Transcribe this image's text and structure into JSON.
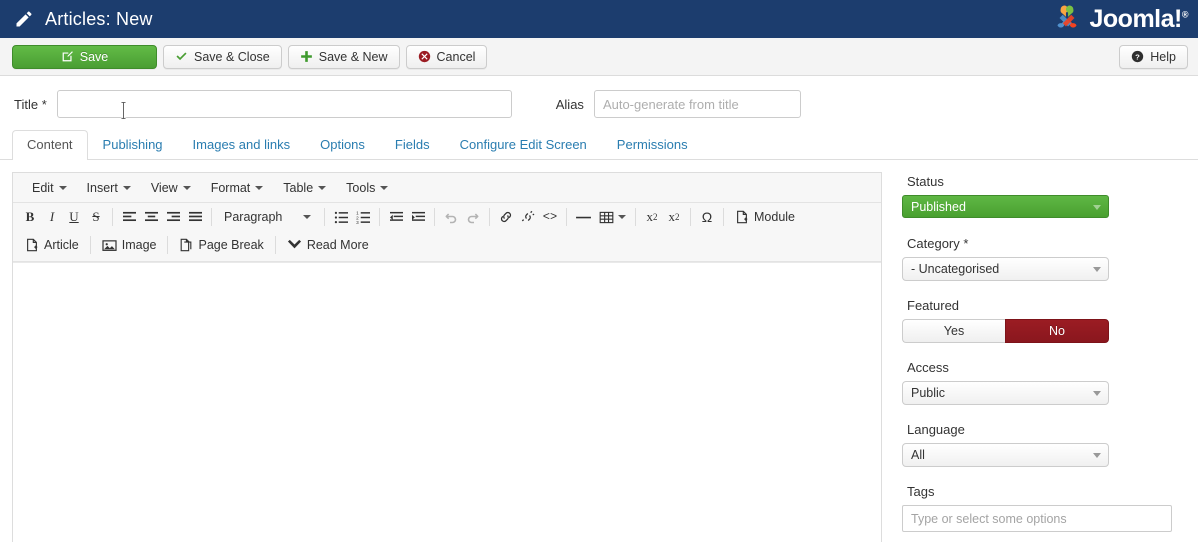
{
  "header": {
    "title": "Articles: New",
    "pencil_icon": "pencil-icon",
    "brand": "Joomla!",
    "brand_sup": "®"
  },
  "toolbar": {
    "save_label": "Save",
    "save_close_label": "Save & Close",
    "save_new_label": "Save & New",
    "cancel_label": "Cancel",
    "help_label": "Help"
  },
  "form": {
    "title_label": "Title *",
    "title_value": "",
    "title_placeholder": "",
    "alias_label": "Alias",
    "alias_value": "",
    "alias_placeholder": "Auto-generate from title"
  },
  "tabs": [
    {
      "label": "Content",
      "active": true
    },
    {
      "label": "Publishing",
      "active": false
    },
    {
      "label": "Images and links",
      "active": false
    },
    {
      "label": "Options",
      "active": false
    },
    {
      "label": "Fields",
      "active": false
    },
    {
      "label": "Configure Edit Screen",
      "active": false
    },
    {
      "label": "Permissions",
      "active": false
    }
  ],
  "editor": {
    "menubar": [
      "Edit",
      "Insert",
      "View",
      "Format",
      "Table",
      "Tools"
    ],
    "format_select": "Paragraph",
    "content": "",
    "row1_buttons": [
      {
        "name": "bold-icon",
        "glyph": "B"
      },
      {
        "name": "italic-icon",
        "glyph": "I"
      },
      {
        "name": "underline-icon",
        "glyph": "U"
      },
      {
        "name": "strikethrough-icon",
        "glyph": "S"
      },
      {
        "name": "align-left-icon",
        "glyph": ""
      },
      {
        "name": "align-center-icon",
        "glyph": ""
      },
      {
        "name": "align-right-icon",
        "glyph": ""
      },
      {
        "name": "align-justify-icon",
        "glyph": ""
      },
      {
        "name": "bullet-list-icon",
        "glyph": ""
      },
      {
        "name": "numbered-list-icon",
        "glyph": ""
      },
      {
        "name": "outdent-icon",
        "glyph": ""
      },
      {
        "name": "indent-icon",
        "glyph": ""
      },
      {
        "name": "undo-icon",
        "glyph": ""
      },
      {
        "name": "redo-icon",
        "glyph": ""
      },
      {
        "name": "link-icon",
        "glyph": ""
      },
      {
        "name": "unlink-icon",
        "glyph": ""
      },
      {
        "name": "source-code-icon",
        "glyph": "<>"
      },
      {
        "name": "horizontal-rule-icon",
        "glyph": "—"
      },
      {
        "name": "table-icon",
        "glyph": ""
      },
      {
        "name": "subscript-icon",
        "glyph": "x₂"
      },
      {
        "name": "superscript-icon",
        "glyph": "x²"
      },
      {
        "name": "special-character-icon",
        "glyph": "Ω"
      }
    ],
    "module_label": "Module",
    "row2_buttons": [
      {
        "name": "insert-article-button",
        "label": "Article"
      },
      {
        "name": "insert-image-button",
        "label": "Image"
      },
      {
        "name": "insert-page-break-button",
        "label": "Page Break"
      },
      {
        "name": "insert-read-more-button",
        "label": "Read More"
      }
    ]
  },
  "sidebar": {
    "status_label": "Status",
    "status_value": "Published",
    "category_label": "Category *",
    "category_value": "- Uncategorised",
    "featured_label": "Featured",
    "featured_yes": "Yes",
    "featured_no": "No",
    "access_label": "Access",
    "access_value": "Public",
    "language_label": "Language",
    "language_value": "All",
    "tags_label": "Tags",
    "tags_placeholder": "Type or select some options"
  },
  "colors": {
    "header_bg": "#1c3d6e",
    "save_green": "#4a9e33",
    "status_green": "#49a030",
    "featured_red": "#8a171e",
    "link_blue": "#2a7db0"
  }
}
